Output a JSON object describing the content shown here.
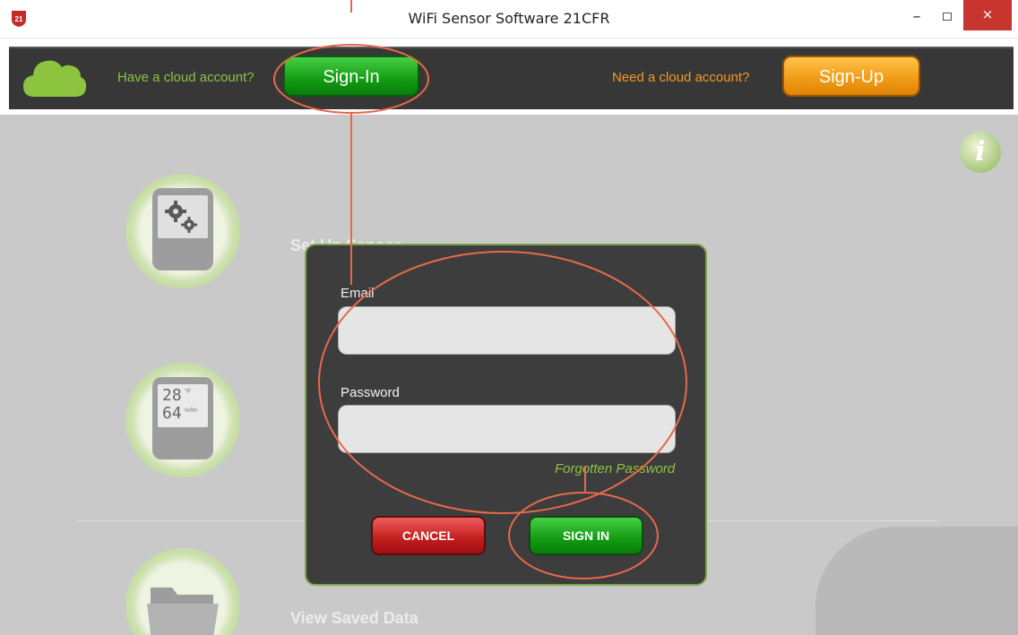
{
  "window": {
    "title": "WiFi Sensor Software 21CFR",
    "minimize_glyph": "–",
    "close_glyph": "×",
    "logo_text": "21"
  },
  "cloud_bar": {
    "have_account_text": "Have a cloud account?",
    "sign_in_label": "Sign-In",
    "need_account_text": "Need a cloud account?",
    "sign_up_label": "Sign-Up"
  },
  "main": {
    "info_glyph": "i",
    "menu": [
      {
        "label": "Set Up Sensor",
        "icon": "gear-device-icon"
      },
      {
        "label": "",
        "icon": "temperature-humidity-display-icon"
      },
      {
        "label": "View Saved Data",
        "icon": "folder-icon"
      }
    ],
    "sensor_display": {
      "temp": "28",
      "temp_unit": "°F",
      "humidity": "64",
      "humidity_unit": "%RH"
    }
  },
  "dialog": {
    "email_label": "Email",
    "email_value": "",
    "password_label": "Password",
    "password_value": "",
    "forgot_password": "Forgotten Password",
    "cancel_label": "CANCEL",
    "sign_in_label": "SIGN IN"
  },
  "colors": {
    "accent_green": "#8cc33f",
    "accent_orange": "#f19a1f",
    "annotation": "#e8694a",
    "dialog_bg": "#3d3d3d"
  }
}
